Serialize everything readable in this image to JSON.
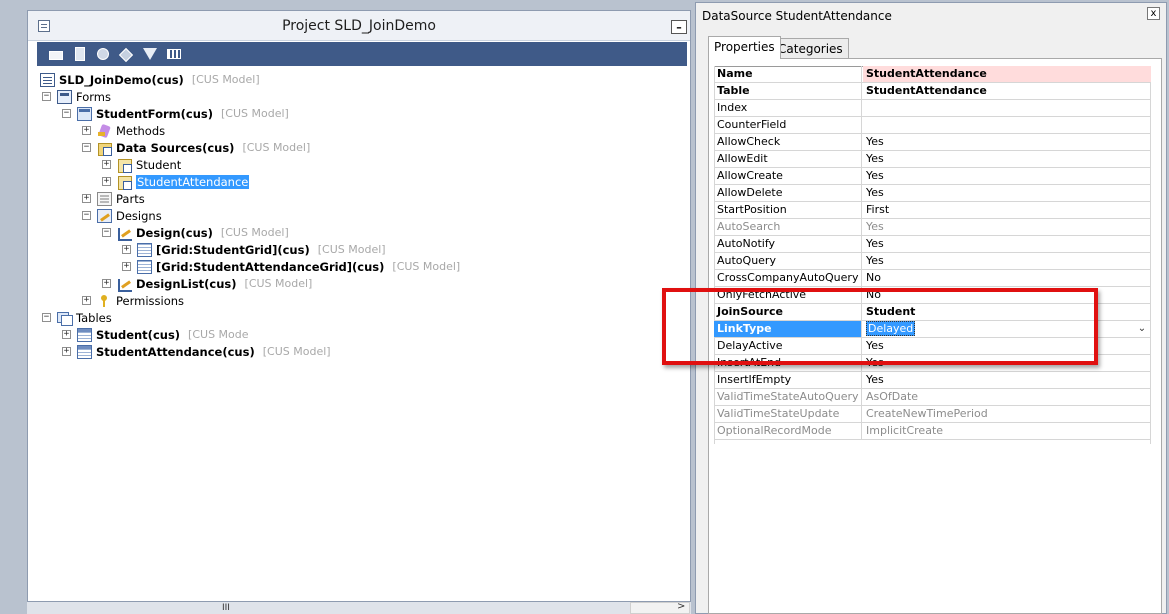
{
  "project_window": {
    "title": "Project SLD_JoinDemo",
    "minimize_label": "–",
    "toolbar": [
      "open-icon",
      "properties-icon",
      "compile-icon",
      "import-icon",
      "filter-icon",
      "layout-icon"
    ],
    "tree": {
      "root": {
        "label": "SLD_JoinDemo(cus)",
        "layer": "[CUS Model]"
      },
      "forms": {
        "label": "Forms"
      },
      "studentform": {
        "label": "StudentForm(cus)",
        "layer": "[CUS Model]"
      },
      "methods": {
        "label": "Methods"
      },
      "datasources": {
        "label": "Data Sources(cus)",
        "layer": "[CUS Model]"
      },
      "ds_student": {
        "label": "Student"
      },
      "ds_studentattendance": {
        "label": "StudentAttendance"
      },
      "parts": {
        "label": "Parts"
      },
      "designs": {
        "label": "Designs"
      },
      "design": {
        "label": "Design(cus)",
        "layer": "[CUS Model]"
      },
      "grid_student": {
        "label": "[Grid:StudentGrid](cus)",
        "layer": "[CUS Model]"
      },
      "grid_attendance": {
        "label": "[Grid:StudentAttendanceGrid](cus)",
        "layer": "[CUS Model]"
      },
      "designlist": {
        "label": "DesignList(cus)",
        "layer": "[CUS Model]"
      },
      "permissions": {
        "label": "Permissions"
      },
      "tables": {
        "label": "Tables"
      },
      "table_student": {
        "label": "Student(cus)",
        "layer": "[CUS Mode"
      },
      "table_attendance": {
        "label": "StudentAttendance(cus)",
        "layer": "[CUS Model]"
      }
    },
    "expander": {
      "plus": "+",
      "minus": "−"
    },
    "hscroll_grip": "III",
    "hscroll_arrow": ">"
  },
  "properties_window": {
    "title": "DataSource StudentAttendance",
    "close_label": "x",
    "tabs": {
      "properties": "Properties",
      "categories": "Categories"
    },
    "rows": [
      {
        "name": "Name",
        "value": "StudentAttendance"
      },
      {
        "name": "Table",
        "value": "StudentAttendance"
      },
      {
        "name": "Index",
        "value": ""
      },
      {
        "name": "CounterField",
        "value": ""
      },
      {
        "name": "AllowCheck",
        "value": "Yes"
      },
      {
        "name": "AllowEdit",
        "value": "Yes"
      },
      {
        "name": "AllowCreate",
        "value": "Yes"
      },
      {
        "name": "AllowDelete",
        "value": "Yes"
      },
      {
        "name": "StartPosition",
        "value": "First"
      },
      {
        "name": "AutoSearch",
        "value": "Yes"
      },
      {
        "name": "AutoNotify",
        "value": "Yes"
      },
      {
        "name": "AutoQuery",
        "value": "Yes"
      },
      {
        "name": "CrossCompanyAutoQuery",
        "value": "No"
      },
      {
        "name": "OnlyFetchActive",
        "value": "No"
      },
      {
        "name": "JoinSource",
        "value": "Student"
      },
      {
        "name": "LinkType",
        "value": "Delayed"
      },
      {
        "name": "DelayActive",
        "value": "Yes"
      },
      {
        "name": "InsertAtEnd",
        "value": "Yes"
      },
      {
        "name": "InsertIfEmpty",
        "value": "Yes"
      },
      {
        "name": "ValidTimeStateAutoQuery",
        "value": "AsOfDate"
      },
      {
        "name": "ValidTimeStateUpdate",
        "value": "CreateNewTimePeriod"
      },
      {
        "name": "OptionalRecordMode",
        "value": "ImplicitCreate"
      }
    ],
    "dropdown_chevron": "⌄"
  },
  "colors": {
    "highlight": "#e01010",
    "selection": "#3399ff",
    "toolbar": "#3f5a88",
    "name_highlight": "#ffdcdc"
  }
}
